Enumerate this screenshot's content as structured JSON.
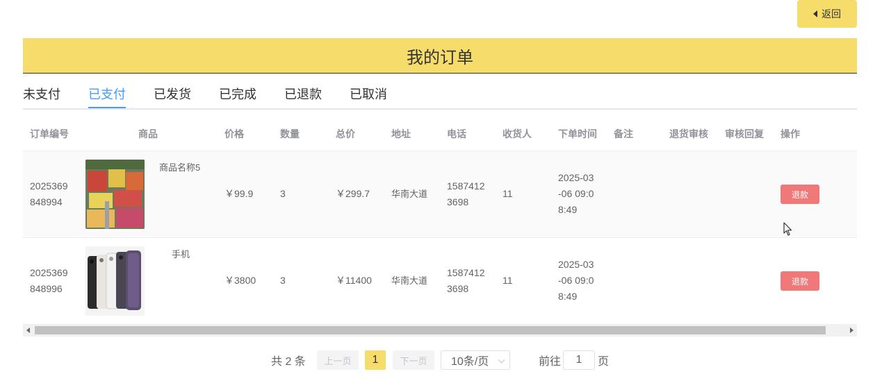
{
  "back_label": "返回",
  "page_title": "我的订单",
  "tabs": [
    {
      "label": "未支付"
    },
    {
      "label": "已支付"
    },
    {
      "label": "已发货"
    },
    {
      "label": "已完成"
    },
    {
      "label": "已退款"
    },
    {
      "label": "已取消"
    }
  ],
  "active_tab": "已支付",
  "columns": {
    "order_no": "订单编号",
    "product": "商品",
    "price": "价格",
    "qty": "数量",
    "total": "总价",
    "address": "地址",
    "phone": "电话",
    "receiver": "收货人",
    "time": "下单时间",
    "remark": "备注",
    "return_review": "退货审核",
    "review_reply": "审核回复",
    "action": "操作"
  },
  "rows": [
    {
      "order_no_1": "2025369",
      "order_no_2": "848994",
      "product_name": "商品名称5",
      "price": "￥99.9",
      "qty": "3",
      "total": "￥299.7",
      "address": "华南大道",
      "phone_1": "1587412",
      "phone_2": "3698",
      "receiver": "11",
      "time_1": "2025-03",
      "time_2": "-06 09:0",
      "time_3": "8:49",
      "action": "退款"
    },
    {
      "order_no_1": "2025369",
      "order_no_2": "848996",
      "product_name": "手机",
      "price": "￥3800",
      "qty": "3",
      "total": "￥11400",
      "address": "华南大道",
      "phone_1": "1587412",
      "phone_2": "3698",
      "receiver": "11",
      "time_1": "2025-03",
      "time_2": "-06 09:0",
      "time_3": "8:49",
      "action": "退款"
    }
  ],
  "pagination": {
    "total": "共 2 条",
    "prev": "上一页",
    "current": "1",
    "next": "下一页",
    "page_size": "10条/页",
    "goto_label": "前往",
    "goto_value": "1",
    "page_suffix": "页"
  },
  "colors": {
    "accent": "#f5dc6b",
    "active_tab": "#409eff",
    "refund": "#f07878"
  }
}
